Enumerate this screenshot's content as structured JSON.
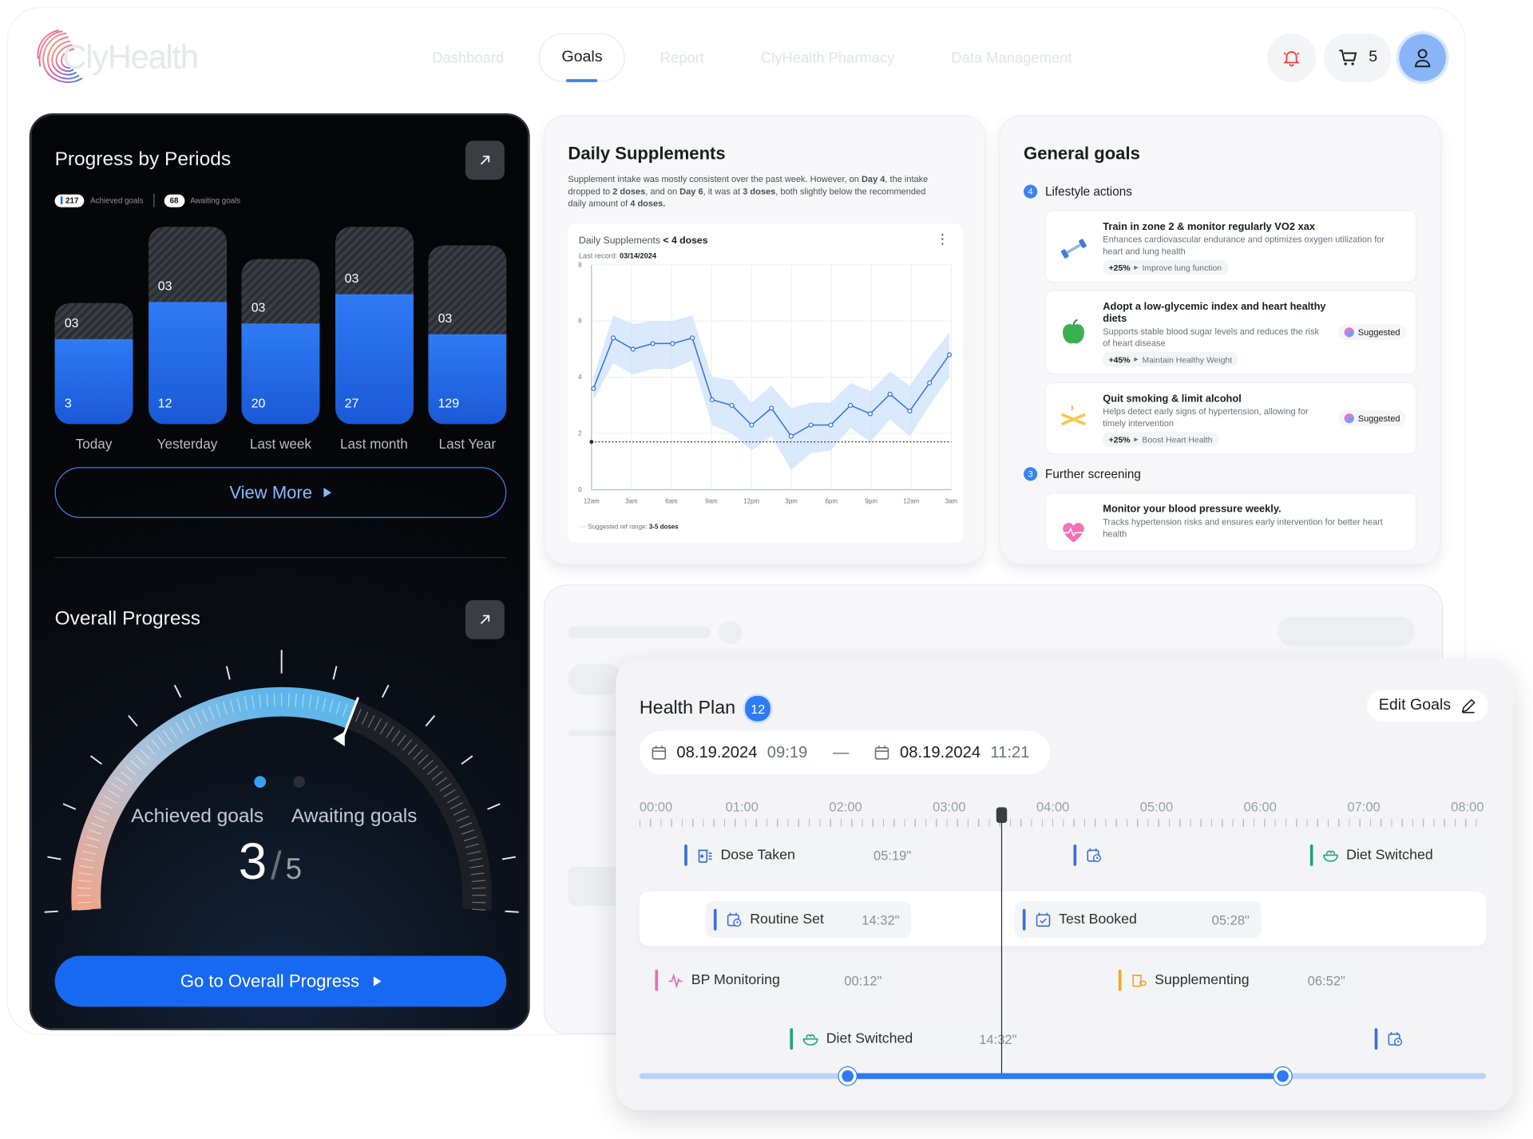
{
  "app": {
    "name": "ClyHealth"
  },
  "nav": {
    "items": [
      "Dashboard",
      "Goals",
      "Report",
      "ClyHealth Pharmacy",
      "Data Management"
    ],
    "active": "Goals"
  },
  "cart": {
    "count": "5"
  },
  "progress_periods": {
    "title": "Progress by Periods",
    "achieved_count": "217",
    "achieved_label": "Achieved goals",
    "awaiting_count": "68",
    "awaiting_label": "Awaiting goals",
    "bars": [
      {
        "label": "Today",
        "top": "03",
        "bottom": "3",
        "total": 0.6,
        "fill": 0.7
      },
      {
        "label": "Yesterday",
        "top": "03",
        "bottom": "12",
        "total": 0.98,
        "fill": 0.62
      },
      {
        "label": "Last week",
        "top": "03",
        "bottom": "20",
        "total": 0.82,
        "fill": 0.61
      },
      {
        "label": "Last month",
        "top": "03",
        "bottom": "27",
        "total": 0.98,
        "fill": 0.66
      },
      {
        "label": "Last Year",
        "top": "03",
        "bottom": "129",
        "total": 0.89,
        "fill": 0.5
      }
    ],
    "view_more": "View More"
  },
  "overall_progress": {
    "title": "Overall Progress",
    "achieved_label": "Achieved goals",
    "awaiting_label": "Awaiting goals",
    "achieved": "3",
    "total": "5",
    "button": "Go to Overall Progress"
  },
  "daily_supplements": {
    "title": "Daily Supplements",
    "desc_1": "Supplement intake was mostly consistent over the past week. However, on ",
    "desc_day4": "Day 4",
    "desc_2": ", the intake dropped to ",
    "desc_doses2": "2 doses",
    "desc_3": ", and on ",
    "desc_day6": "Day 6",
    "desc_4": ", it was at ",
    "desc_doses3": "3 doses",
    "desc_5": ", both slightly below the recommended daily amount of ",
    "desc_doses4": "4 doses.",
    "chart_title": "Daily Supplements",
    "chart_title_bold": "< 4 doses",
    "last_record_label": "Last record:",
    "last_record": "03/14/2024",
    "ref_label": "Suggested ref range:",
    "ref_value": "3-5 doses"
  },
  "chart_data": {
    "type": "line",
    "title": "Daily Supplements",
    "x": [
      "12am",
      "3am",
      "6am",
      "9am",
      "12pm",
      "3pm",
      "6pm",
      "9pm",
      "12am",
      "3am"
    ],
    "ylim": [
      0,
      8
    ],
    "yticks": [
      0,
      2,
      4,
      6,
      8
    ],
    "series": [
      {
        "values": [
          3.6,
          5.4,
          5.0,
          5.2,
          5.2,
          5.4,
          3.2,
          3.0,
          2.3,
          2.9,
          1.9,
          2.3,
          2.3,
          3.0,
          2.7,
          3.4,
          2.8,
          3.8,
          4.8
        ]
      }
    ],
    "band_low": [
      3.2,
      4.5,
      4.1,
      4.3,
      4.3,
      4.6,
      2.3,
      2.0,
      1.4,
      1.9,
      0.7,
      1.3,
      1.4,
      2.2,
      1.7,
      2.5,
      1.9,
      3.0,
      4.0
    ],
    "band_high": [
      4.0,
      6.2,
      5.9,
      6.0,
      6.0,
      6.2,
      4.0,
      3.9,
      3.1,
      3.7,
      2.9,
      3.1,
      3.1,
      3.8,
      3.5,
      4.2,
      3.7,
      4.7,
      5.6
    ],
    "ref_line": 1.7
  },
  "general_goals": {
    "title": "General goals",
    "section1": {
      "count": "4",
      "label": "Lifestyle actions"
    },
    "section2": {
      "count": "3",
      "label": "Further screening"
    },
    "items": [
      {
        "title": "Train in zone 2 & monitor regularly VO2 xax",
        "desc": "Enhances cardiovascular endurance and optimizes oxygen utilization for heart and lung health",
        "pct": "+25%",
        "tag": "Improve lung function",
        "suggested": ""
      },
      {
        "title": "Adopt a low-glycemic index and heart healthy diets",
        "desc": "Supports stable blood sugar levels and reduces the risk of heart disease",
        "pct": "+45%",
        "tag": "Maintain Healthy Weight",
        "suggested": "Suggested"
      },
      {
        "title": "Quit smoking & limit alcohol",
        "desc": "Helps detect early signs of hypertension, allowing for timely intervention",
        "pct": "+25%",
        "tag": "Boost Heart Health",
        "suggested": "Suggested"
      },
      {
        "title": "Monitor your blood pressure weekly.",
        "desc": "Tracks hypertension risks and ensures early intervention for better heart health"
      }
    ]
  },
  "health_plan": {
    "title": "Health Plan",
    "count": "12",
    "edit": "Edit Goals",
    "start_date": "08.19.2024",
    "start_time": "09:19",
    "end_date": "08.19.2024",
    "end_time": "11:21",
    "dash": "—",
    "scale": [
      "00:00",
      "01:00",
      "02:00",
      "03:00",
      "04:00",
      "05:00",
      "06:00",
      "07:00",
      "08:00"
    ],
    "events": [
      {
        "name": "Dose Taken",
        "dur": "05:19\""
      },
      {
        "name": "Diet Switched",
        "dur": ""
      },
      {
        "name": "Routine Set",
        "dur": "14:32\""
      },
      {
        "name": "Test Booked",
        "dur": "05:28\""
      },
      {
        "name": "BP Monitoring",
        "dur": "00:12\""
      },
      {
        "name": "Supplementing",
        "dur": "06:52\""
      },
      {
        "name": "Diet Switched",
        "dur": "14:32\""
      }
    ],
    "colors": {
      "blue": "#3b6fd8",
      "green": "#1fa37a",
      "pink": "#f06bb4",
      "orange": "#f5a524"
    }
  }
}
